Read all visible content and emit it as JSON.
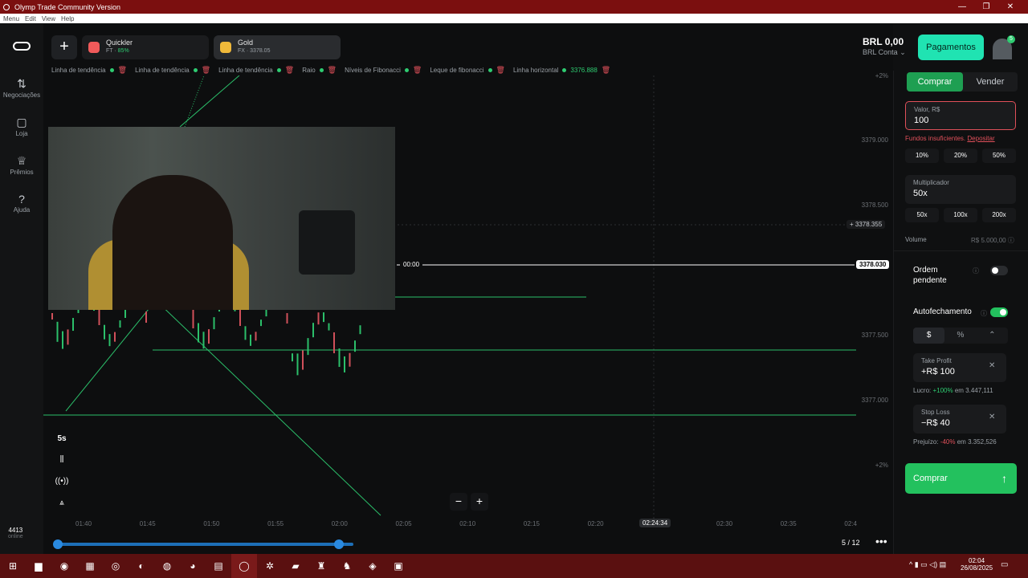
{
  "window": {
    "title": "Olymp Trade Community Version",
    "minimize": "—",
    "maximize": "❐",
    "close": "✕"
  },
  "menu": [
    "Menu",
    "Edit",
    "View",
    "Help"
  ],
  "sidebar": [
    {
      "icon": "⇅",
      "label": "Negociações"
    },
    {
      "icon": "▢",
      "label": "Loja"
    },
    {
      "icon": "♕",
      "label": "Prêmios"
    },
    {
      "icon": "?",
      "label": "Ajuda"
    }
  ],
  "tabs": [
    {
      "name": "Quickler",
      "sub": "FT · ",
      "pct": "85%",
      "color": "#f05a5a"
    },
    {
      "name": "Gold",
      "sub": "FX · 3378.05",
      "color": "#f0b93a"
    }
  ],
  "tools": [
    {
      "label": "Linha de tendência"
    },
    {
      "label": "Linha de tendência"
    },
    {
      "label": "Linha de tendência"
    },
    {
      "label": "Raio"
    },
    {
      "label": "Níveis de Fibonacci"
    },
    {
      "label": "Leque de fibonacci"
    },
    {
      "label": "Linha horizontal",
      "value": "3376.888"
    }
  ],
  "account": {
    "balance": "BRL 0,00",
    "type": "BRL Conta",
    "payments": "Pagamentos",
    "badge": "5"
  },
  "price_axis": [
    "+2%",
    "3379.000",
    "3378.500",
    "3378.355",
    "3378.030",
    "3377.500",
    "3377.000",
    "+2%"
  ],
  "time_axis": [
    "01:40",
    "01:45",
    "01:50",
    "01:55",
    "02:00",
    "02:05",
    "02:10",
    "02:15",
    "02:20",
    "02:24:34",
    "02:30",
    "02:35",
    "02:4"
  ],
  "chart": {
    "countdown": "00:00",
    "timeframe": "5s",
    "online_count": "4413",
    "online_label": "online",
    "pages": "5 / 12"
  },
  "panel": {
    "buy": "Comprar",
    "sell": "Vender",
    "value_label": "Valor, R$",
    "value": "100",
    "insufficient": "Fundos insuficientes.",
    "deposit": "Depositar",
    "percents": [
      "10%",
      "20%",
      "50%"
    ],
    "mult_label": "Multiplicador",
    "mult": "50x",
    "mults": [
      "50x",
      "100x",
      "200x"
    ],
    "volume_label": "Volume",
    "volume": "R$ 5.000,00",
    "pending": "Ordem pendente",
    "pending_on": false,
    "autoclose": "Autofechamento",
    "autoclose_on": true,
    "modes": [
      "$",
      "%",
      "⌃"
    ],
    "tp_label": "Take Profit",
    "tp": "+R$ 100",
    "profit_label": "Lucro:",
    "profit_pct": "+100%",
    "profit_at": "em 3.447,111",
    "sl_label": "Stop Loss",
    "sl": "−R$ 40",
    "loss_label": "Prejuízo:",
    "loss_pct": "-40%",
    "loss_at": "em 3.352,526",
    "buy_big": "Comprar"
  },
  "taskbar": {
    "time": "02:04",
    "date": "26/08/2025"
  },
  "colors": {
    "green": "#23c15e",
    "red": "#e0505a",
    "accent": "#20e3b2"
  }
}
